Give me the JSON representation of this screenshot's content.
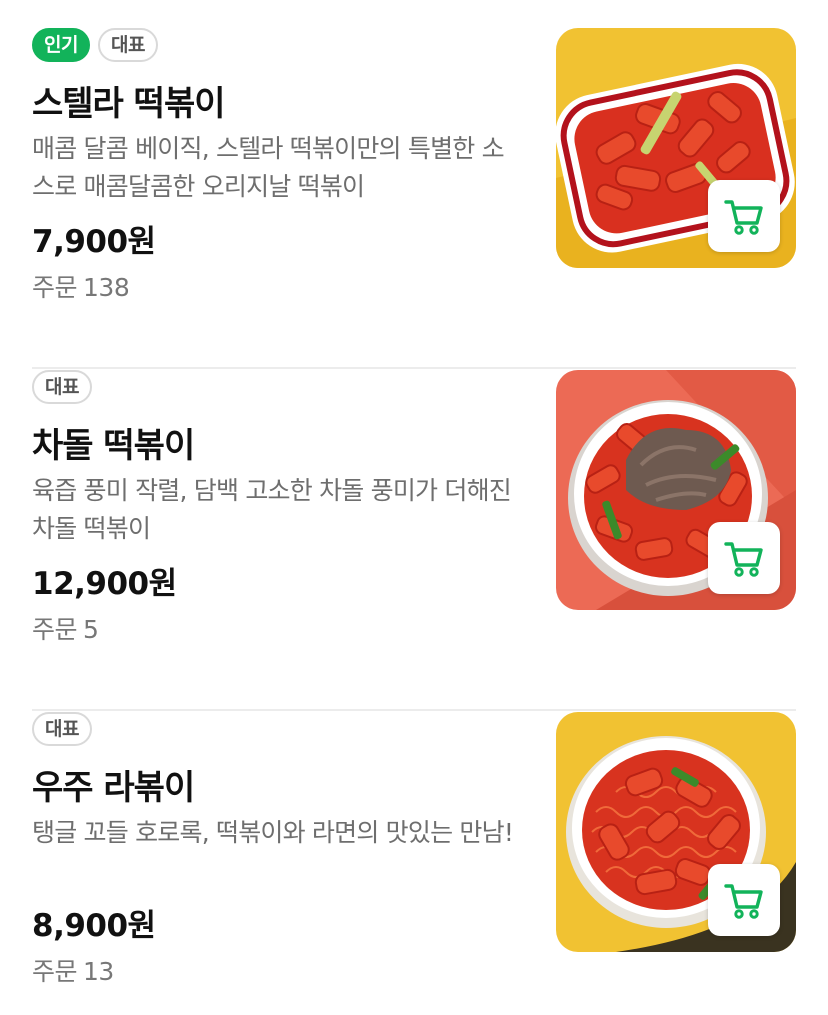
{
  "menu_items": [
    {
      "badges": [
        "인기",
        "대표"
      ],
      "name": "스텔라 떡볶이",
      "description": "매콤 달콤 베이직, 스텔라 떡볶이만의 특별한 소스로 매콤달콤한 오리지날 떡볶이",
      "price": "7,900원",
      "orders_label": "주문",
      "orders_count": "138",
      "thumbnail_bg": "#f1c232",
      "cart_icon": "cart-icon"
    },
    {
      "badges": [
        "대표"
      ],
      "name": "차돌 떡볶이",
      "description": "육즙 풍미 작렬, 담백 고소한 차돌 풍미가 더해진 차돌 떡볶이",
      "price": "12,900원",
      "orders_label": "주문",
      "orders_count": "5",
      "thumbnail_bg": "#ec6a55",
      "cart_icon": "cart-icon"
    },
    {
      "badges": [
        "대표"
      ],
      "name": "우주 라볶이",
      "description": "탱글 꼬들 호로록, 떡볶이와 라면의 맛있는 만남!",
      "price": "8,900원",
      "orders_label": "주문",
      "orders_count": "13",
      "thumbnail_bg": "#f1c232",
      "cart_icon": "cart-icon"
    }
  ],
  "colors": {
    "accent_green": "#12b35a",
    "badge_border": "#d9d9d9",
    "divider": "#ececec"
  }
}
